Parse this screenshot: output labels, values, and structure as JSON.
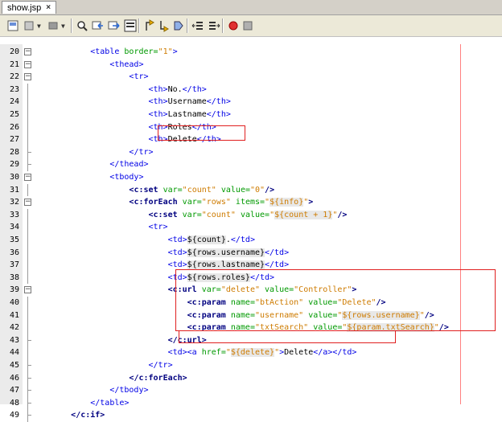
{
  "tab": {
    "title": "show.jsp",
    "close": "×"
  },
  "toolbar": {
    "icons": [
      "source-icon",
      "history-icon",
      "back-icon",
      "forward-icon",
      "find-icon",
      "find-prev-icon",
      "find-next-icon",
      "toggle-highlight-icon",
      "prev-bookmark-icon",
      "next-bookmark-icon",
      "toggle-bookmark-icon",
      "shift-left-icon",
      "shift-right-icon",
      "record-macro-icon",
      "stop-macro-icon"
    ]
  },
  "lines": [
    {
      "n": "20",
      "html": "            <span class='tag'>&lt;table</span> <span class='attr'>border=</span><span class='val'>\"1\"</span><span class='tag'>&gt;</span>"
    },
    {
      "n": "21",
      "html": "                <span class='tag'>&lt;thead&gt;</span>"
    },
    {
      "n": "22",
      "html": "                    <span class='tag'>&lt;tr&gt;</span>"
    },
    {
      "n": "23",
      "html": "                        <span class='tag'>&lt;th&gt;</span>No.<span class='tag'>&lt;/th&gt;</span>"
    },
    {
      "n": "24",
      "html": "                        <span class='tag'>&lt;th&gt;</span>Username<span class='tag'>&lt;/th&gt;</span>"
    },
    {
      "n": "25",
      "html": "                        <span class='tag'>&lt;th&gt;</span>Lastname<span class='tag'>&lt;/th&gt;</span>"
    },
    {
      "n": "26",
      "html": "                        <span class='tag'>&lt;th&gt;</span>Roles<span class='tag'>&lt;/th&gt;</span>"
    },
    {
      "n": "27",
      "html": "                        <span class='tag'>&lt;th&gt;</span>Delete<span class='tag'>&lt;/th&gt;</span>"
    },
    {
      "n": "28",
      "html": "                    <span class='tag'>&lt;/tr&gt;</span>"
    },
    {
      "n": "29",
      "html": "                <span class='tag'>&lt;/thead&gt;</span>"
    },
    {
      "n": "30",
      "html": "                <span class='tag'>&lt;tbody&gt;</span>"
    },
    {
      "n": "31",
      "html": "                    <span class='jtag'>&lt;c:set</span> <span class='attr'>var=</span><span class='val'>\"count\"</span> <span class='attr'>value=</span><span class='val'>\"0\"</span><span class='jtag'>/&gt;</span>"
    },
    {
      "n": "32",
      "html": "                    <span class='jtag'>&lt;c:forEach</span> <span class='attr'>var=</span><span class='val'>\"rows\"</span> <span class='attr'>items=</span><span class='val'>\"<span class='el'>${info}</span>\"</span><span class='jtag'>&gt;</span>"
    },
    {
      "n": "33",
      "html": "                        <span class='jtag'>&lt;c:set</span> <span class='attr'>var=</span><span class='val'>\"count\"</span> <span class='attr'>value=</span><span class='val'>\"<span class='el'>${count + 1}</span>\"</span><span class='jtag'>/&gt;</span>"
    },
    {
      "n": "34",
      "html": "                        <span class='tag'>&lt;tr&gt;</span>"
    },
    {
      "n": "35",
      "html": "                            <span class='tag'>&lt;td&gt;</span><span class='el'>${count}</span>.<span class='tag'>&lt;/td&gt;</span>"
    },
    {
      "n": "36",
      "html": "                            <span class='tag'>&lt;td&gt;</span><span class='el'>${rows.username}</span><span class='tag'>&lt;/td&gt;</span>"
    },
    {
      "n": "37",
      "html": "                            <span class='tag'>&lt;td&gt;</span><span class='el'>${rows.lastname}</span><span class='tag'>&lt;/td&gt;</span>"
    },
    {
      "n": "38",
      "html": "                            <span class='tag'>&lt;td&gt;</span><span class='el'>${rows.roles}</span><span class='tag'>&lt;/td&gt;</span>"
    },
    {
      "n": "39",
      "html": "                            <span class='jtag'>&lt;c:url</span> <span class='attr'>var=</span><span class='val'>\"delete\"</span> <span class='attr'>value=</span><span class='val'>\"Controller\"</span><span class='jtag'>&gt;</span>"
    },
    {
      "n": "40",
      "html": "                                <span class='jtag'>&lt;c:param</span> <span class='attr'>name=</span><span class='val'>\"btAction\"</span> <span class='attr'>value=</span><span class='val'>\"Delete\"</span><span class='jtag'>/&gt;</span>"
    },
    {
      "n": "41",
      "html": "                                <span class='jtag'>&lt;c:param</span> <span class='attr'>name=</span><span class='val'>\"username\"</span> <span class='attr'>value=</span><span class='val'>\"<span class='el'>${rows.username}</span>\"</span><span class='jtag'>/&gt;</span>"
    },
    {
      "n": "42",
      "html": "                                <span class='jtag'>&lt;c:param</span> <span class='attr'>name=</span><span class='val'>\"txtSearch\"</span> <span class='attr'>value=</span><span class='val'>\"<span class='el'>${param.txtSearch}</span>\"</span><span class='jtag'>/&gt;</span>"
    },
    {
      "n": "43",
      "html": "                            <span class='jtag'>&lt;/c:url&gt;</span>"
    },
    {
      "n": "44",
      "html": "                            <span class='tag'>&lt;td&gt;&lt;a</span> <span class='attr'>href=</span><span class='val'>\"<span class='el'>${delete}</span>\"</span><span class='tag'>&gt;</span>Delete<span class='tag'>&lt;/a&gt;&lt;/td&gt;</span>"
    },
    {
      "n": "45",
      "html": "                        <span class='tag'>&lt;/tr&gt;</span>"
    },
    {
      "n": "46",
      "html": "                    <span class='jtag'>&lt;/c:forEach&gt;</span>"
    },
    {
      "n": "47",
      "html": "                <span class='tag'>&lt;/tbody&gt;</span>"
    },
    {
      "n": "48",
      "html": "            <span class='tag'>&lt;/table&gt;</span>"
    },
    {
      "n": "49",
      "html": "        <span class='jtag'>&lt;/c:if&gt;</span>"
    }
  ],
  "folds": {
    "open": [
      "20",
      "21",
      "22",
      "30",
      "32",
      "39"
    ],
    "close": [
      "28",
      "29",
      "43",
      "45",
      "46",
      "47",
      "48",
      "49"
    ]
  }
}
